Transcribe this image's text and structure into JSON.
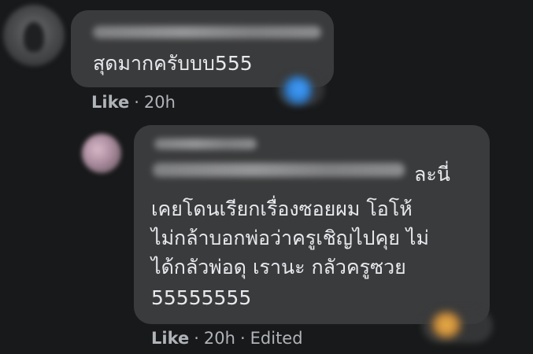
{
  "comments": [
    {
      "text": "สุดมากครับบบ555",
      "like_label": "Like",
      "separator": "·",
      "time": "20h",
      "reaction_icon": "reaction-emoji-blue"
    }
  ],
  "reply": {
    "lines": [
      "ละนี่",
      "เคยโดนเรียกเรื่องซอยผม โอโห้",
      "ไม่กล้าบอกพ่อว่าครูเชิญไปคุย ไม่",
      "ได้กลัวพ่อดุ เรานะ กลัวครูซวย",
      "55555555"
    ],
    "like_label": "Like",
    "separator": "·",
    "time": "20h",
    "edited_label": "Edited",
    "reaction_icon": "reaction-emoji-orange"
  },
  "colors": {
    "background": "#18191a",
    "bubble": "#3a3b3c",
    "text": "#e8e9ed",
    "meta": "#b0b3b8"
  }
}
